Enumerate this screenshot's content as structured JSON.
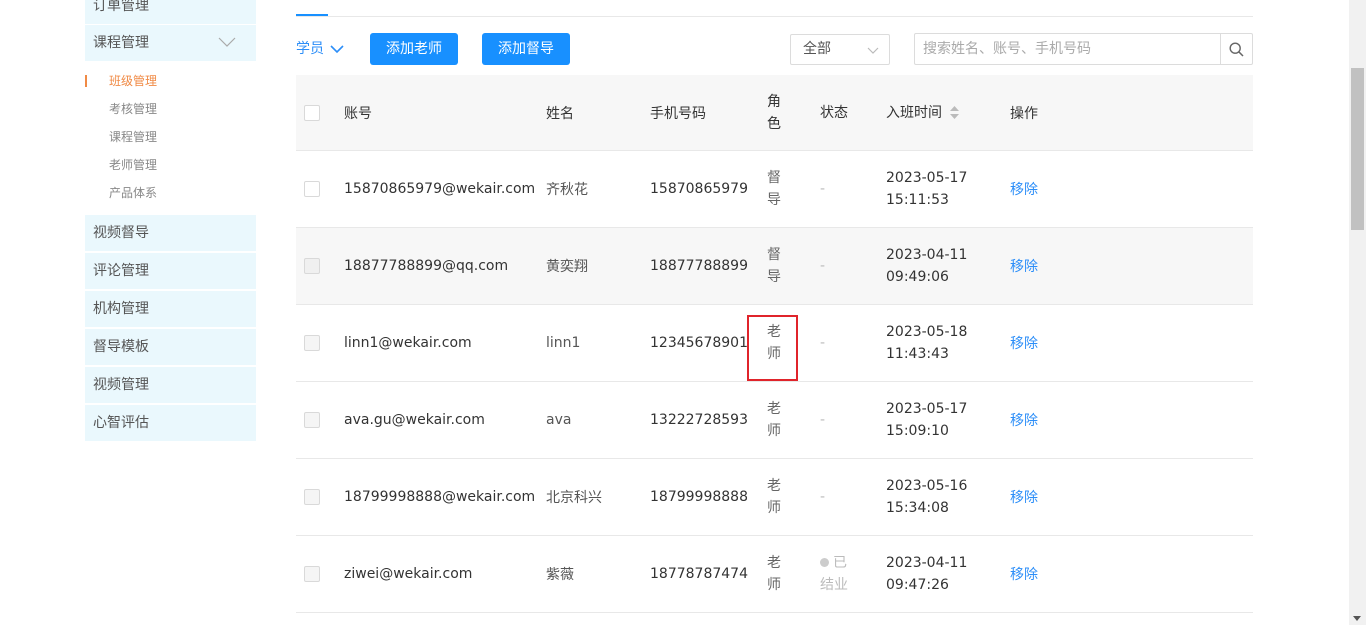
{
  "sidebar": {
    "partial_item": "订单管理",
    "course_management": "课程管理",
    "sub_items": [
      {
        "label": "班级管理",
        "active": true
      },
      {
        "label": "考核管理",
        "active": false
      },
      {
        "label": "课程管理",
        "active": false
      },
      {
        "label": "老师管理",
        "active": false
      },
      {
        "label": "产品体系",
        "active": false
      }
    ],
    "items": [
      "视频督导",
      "评论管理",
      "机构管理",
      "督导模板",
      "视频管理",
      "心智评估"
    ]
  },
  "toolbar": {
    "role_filter": "学员",
    "add_teacher": "添加老师",
    "add_supervisor": "添加督导",
    "select_value": "全部",
    "search_placeholder": "搜索姓名、账号、手机号码"
  },
  "table": {
    "headers": {
      "account": "账号",
      "name": "姓名",
      "phone": "手机号码",
      "role_line1": "角",
      "role_line2": "色",
      "status": "状态",
      "join_time": "入班时间",
      "action": "操作"
    },
    "rows": [
      {
        "account": "15870865979@wekair.com",
        "name": "齐秋花",
        "phone": "15870865979",
        "role1": "督",
        "role2": "导",
        "status1": "-",
        "status2": "",
        "date": "2023-05-17",
        "time": "15:11:53",
        "action": "移除"
      },
      {
        "account": "18877788899@qq.com",
        "name": "黄奕翔",
        "phone": "18877788899",
        "role1": "督",
        "role2": "导",
        "status1": "-",
        "status2": "",
        "date": "2023-04-11",
        "time": "09:49:06",
        "action": "移除"
      },
      {
        "account": "linn1@wekair.com",
        "name": "linn1",
        "phone": "12345678901",
        "role1": "老",
        "role2": "师",
        "status1": "-",
        "status2": "",
        "date": "2023-05-18",
        "time": "11:43:43",
        "action": "移除"
      },
      {
        "account": "ava.gu@wekair.com",
        "name": "ava",
        "phone": "13222728593",
        "role1": "老",
        "role2": "师",
        "status1": "-",
        "status2": "",
        "date": "2023-05-17",
        "time": "15:09:10",
        "action": "移除"
      },
      {
        "account": "18799998888@wekair.com",
        "name": "北京科兴",
        "phone": "18799998888",
        "role1": "老",
        "role2": "师",
        "status1": "-",
        "status2": "",
        "date": "2023-05-16",
        "time": "15:34:08",
        "action": "移除"
      },
      {
        "account": "ziwei@wekair.com",
        "name": "紫薇",
        "phone": "18778787474",
        "role1": "老",
        "role2": "师",
        "status1": "已",
        "status2": "结业",
        "date": "2023-04-11",
        "time": "09:47:26",
        "action": "移除"
      }
    ]
  },
  "colors": {
    "primary": "#1890ff",
    "link": "#2c8ef8",
    "active_sub": "#f08a45",
    "highlight": "#e0242b",
    "sidebar_bg": "#eaf8fd"
  }
}
